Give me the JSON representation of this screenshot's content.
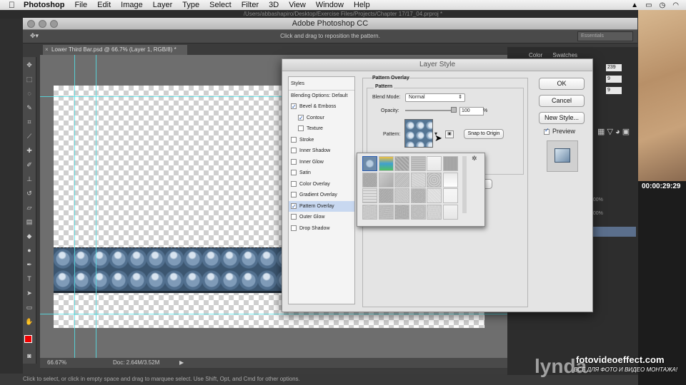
{
  "menubar": {
    "app": "Photoshop",
    "items": [
      "File",
      "Edit",
      "Image",
      "Layer",
      "Type",
      "Select",
      "Filter",
      "3D",
      "View",
      "Window",
      "Help"
    ]
  },
  "background_path": "/Users/abbashapiro/Desktop/Exercise Files/Projects/Chapter 17/17_04.prproj *",
  "ps_window_title": "Adobe Photoshop CC",
  "options_bar": {
    "hint": "Click and drag to reposition the pattern.",
    "workspace": "Essentials"
  },
  "document": {
    "tab_label": "Lower Third Bar.psd @ 66.7% (Layer 1, RGB/8) *",
    "zoom": "66.67%",
    "doc_size": "Doc: 2.64M/3.52M"
  },
  "status_hint": "Click to select, or click in empty space and drag to marquee select. Use Shift, Opt, and Cmd for other options.",
  "right_panel": {
    "tab_color": "Color",
    "tab_swatches": "Swatches",
    "values": [
      "239",
      "9",
      "9"
    ],
    "timecode": "00:00:29:29",
    "values_small": [
      "100%",
      "100%"
    ]
  },
  "layer_style": {
    "title": "Layer Style",
    "styles_header": "Styles",
    "blending": "Blending Options: Default",
    "items": [
      {
        "label": "Bevel & Emboss",
        "checked": true,
        "indent": false,
        "selected": false
      },
      {
        "label": "Contour",
        "checked": true,
        "indent": true,
        "selected": false
      },
      {
        "label": "Texture",
        "checked": false,
        "indent": true,
        "selected": false
      },
      {
        "label": "Stroke",
        "checked": false,
        "indent": false,
        "selected": false
      },
      {
        "label": "Inner Shadow",
        "checked": false,
        "indent": false,
        "selected": false
      },
      {
        "label": "Inner Glow",
        "checked": false,
        "indent": false,
        "selected": false
      },
      {
        "label": "Satin",
        "checked": false,
        "indent": false,
        "selected": false
      },
      {
        "label": "Color Overlay",
        "checked": false,
        "indent": false,
        "selected": false
      },
      {
        "label": "Gradient Overlay",
        "checked": false,
        "indent": false,
        "selected": false
      },
      {
        "label": "Pattern Overlay",
        "checked": true,
        "indent": false,
        "selected": true
      },
      {
        "label": "Outer Glow",
        "checked": false,
        "indent": false,
        "selected": false
      },
      {
        "label": "Drop Shadow",
        "checked": false,
        "indent": false,
        "selected": false
      }
    ],
    "section_title": "Pattern Overlay",
    "group_title": "Pattern",
    "blend_mode_label": "Blend Mode:",
    "blend_mode_value": "Normal",
    "opacity_label": "Opacity:",
    "opacity_value": "100",
    "opacity_unit": "%",
    "pattern_label": "Pattern:",
    "snap_button": "Snap to Origin",
    "buttons": {
      "ok": "OK",
      "cancel": "Cancel",
      "new_style": "New Style...",
      "preview": "Preview"
    },
    "preview_checked": true
  },
  "watermark": {
    "line1": "fotovideoeffect.com",
    "line2": "ВСЁ ДЛЯ ФОТО И ВИДЕО МОНТАЖА!",
    "brand": "lynda"
  }
}
